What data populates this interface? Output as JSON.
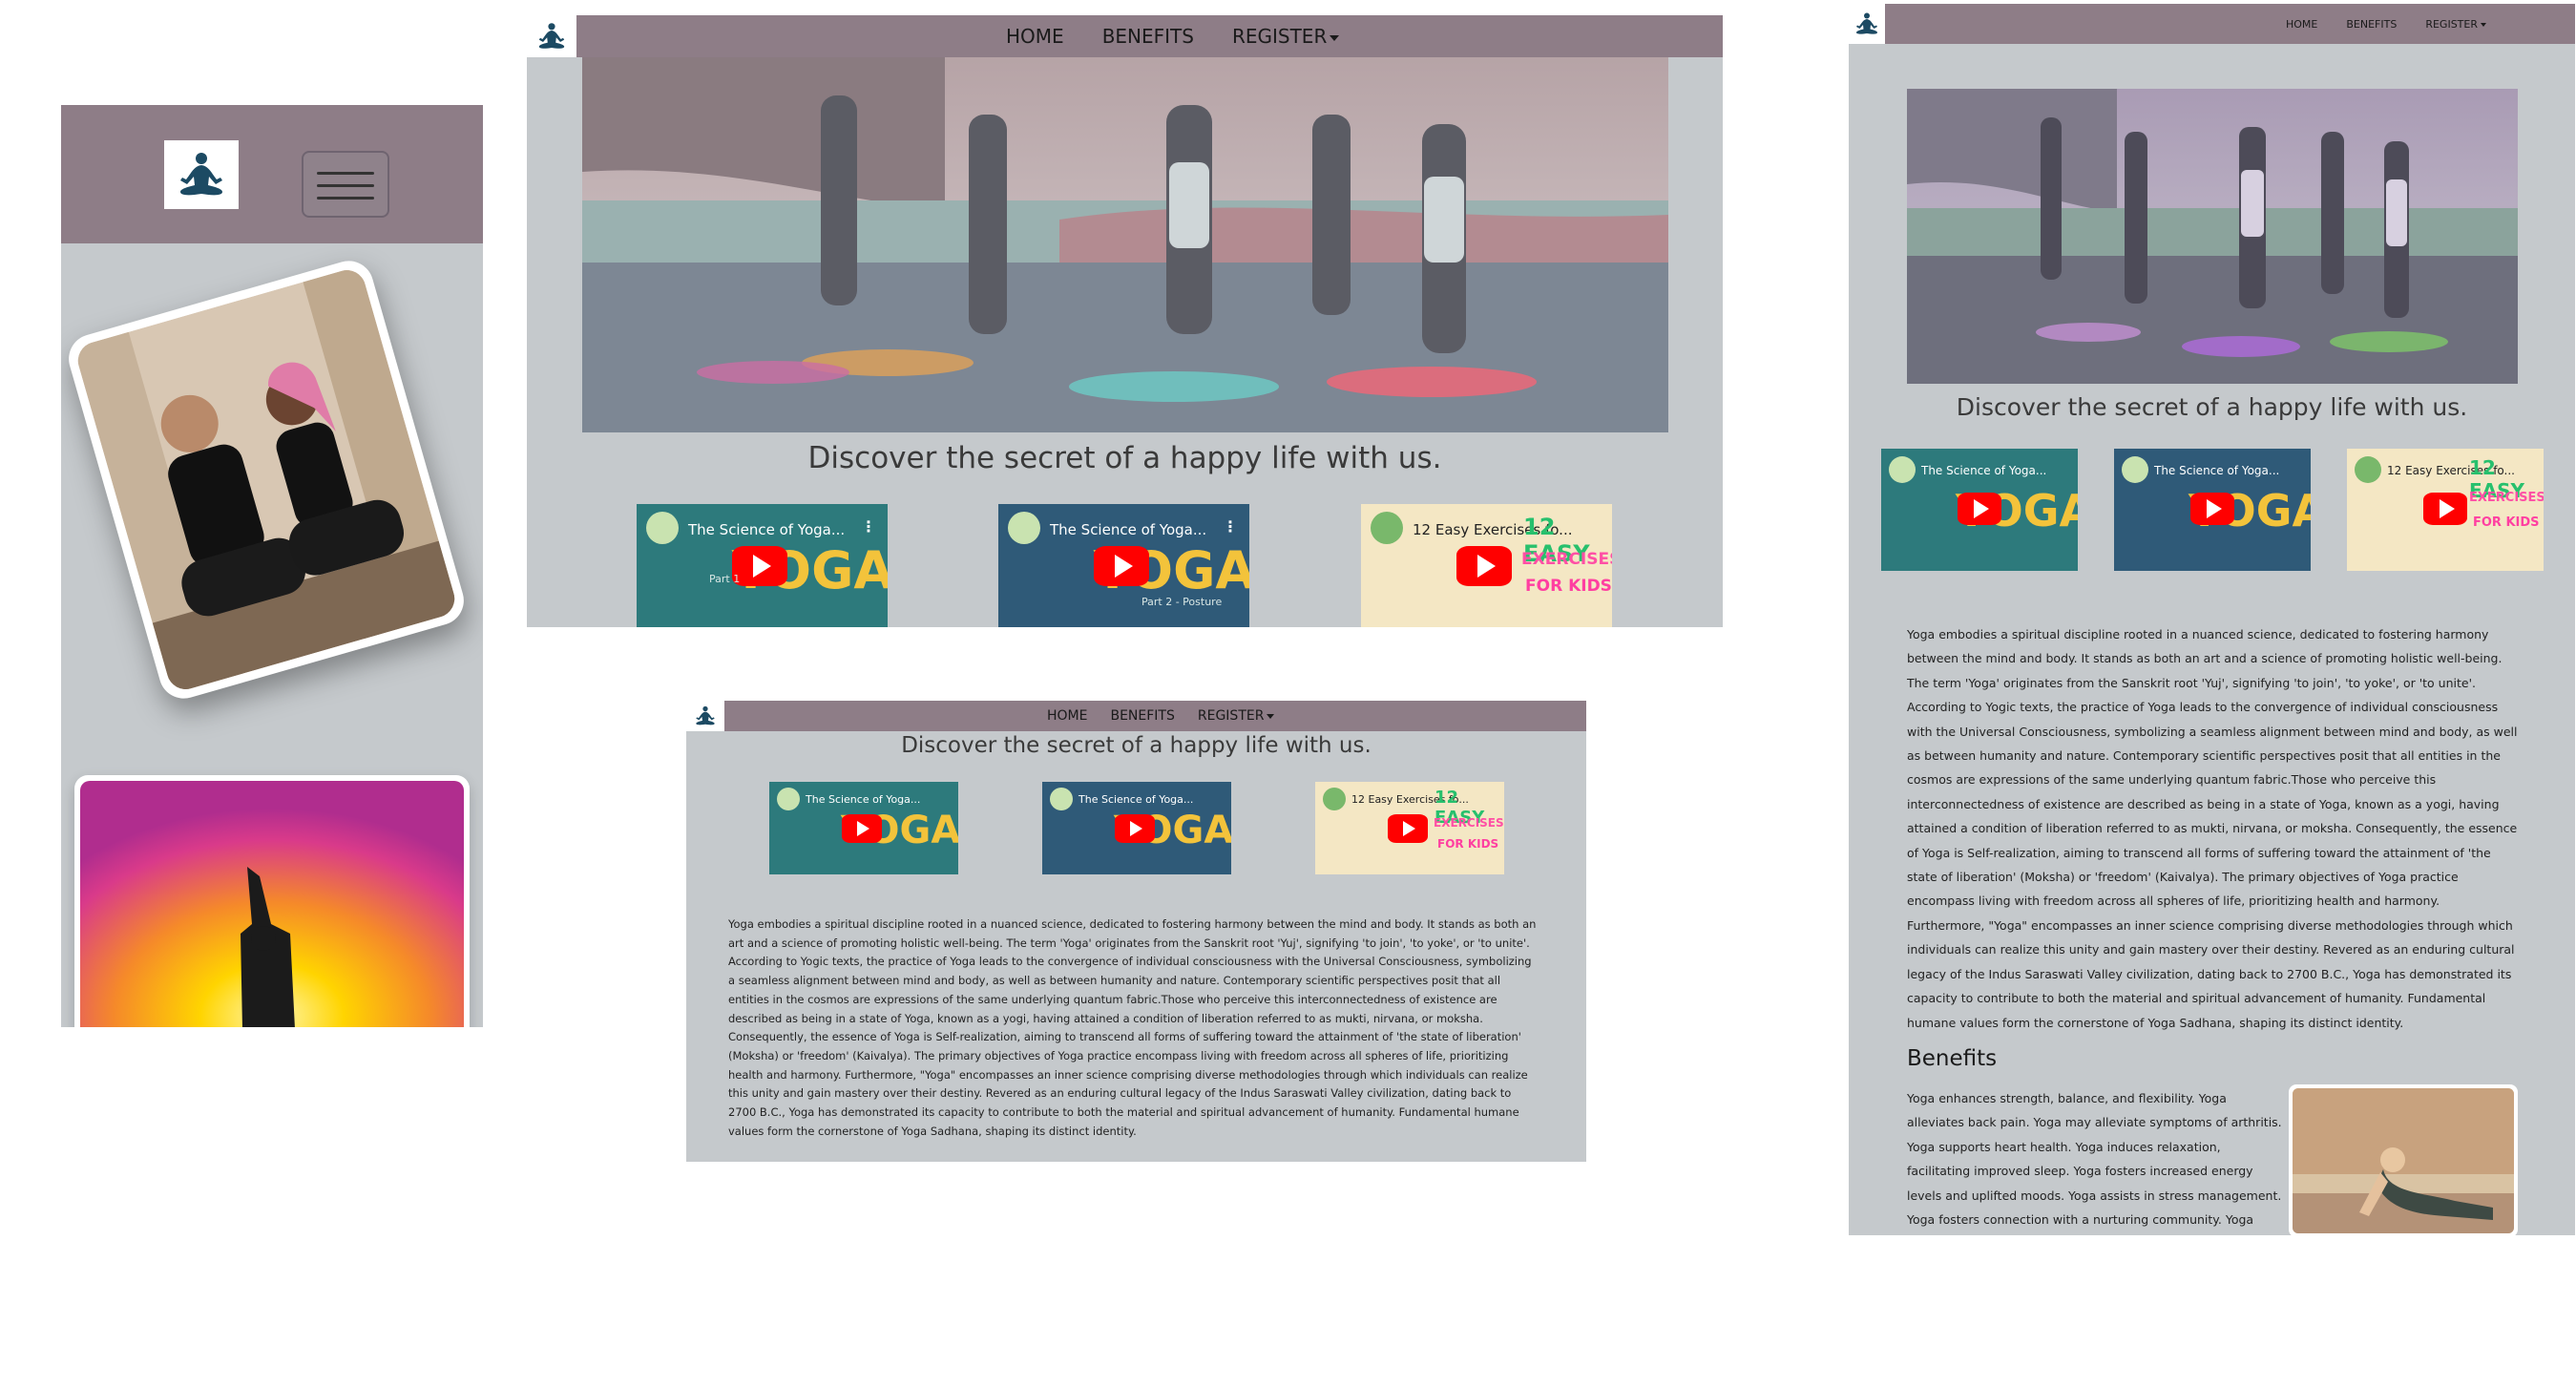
{
  "nav": {
    "home": "HOME",
    "benefits": "BENEFITS",
    "register": "REGISTER"
  },
  "tagline": "Discover the secret of a happy life with us.",
  "videos": [
    {
      "title": "The Science of Yoga...",
      "big": "YOGA",
      "sub": "Part 1"
    },
    {
      "title": "The Science of Yoga...",
      "big": "YOGA",
      "sub": "Part 2 - Posture"
    },
    {
      "title": "12 Easy Exercises fo...",
      "big": "12 EASY",
      "sub": "EXERCISES",
      "kids": "FOR KIDS"
    }
  ],
  "about_text": "Yoga embodies a spiritual discipline rooted in a nuanced science, dedicated to fostering harmony between the mind and body. It stands as both an art and a science of promoting holistic well-being. The term 'Yoga' originates from the Sanskrit root 'Yuj', signifying 'to join', 'to yoke', or 'to unite'. According to Yogic texts, the practice of Yoga leads to the convergence of individual consciousness with the Universal Consciousness, symbolizing a seamless alignment between mind and body, as well as between humanity and nature. Contemporary scientific perspectives posit that all entities in the cosmos are expressions of the same underlying quantum fabric.Those who perceive this interconnectedness of existence are described as being in a state of Yoga, known as a yogi, having attained a condition of liberation referred to as mukti, nirvana, or moksha. Consequently, the essence of Yoga is Self-realization, aiming to transcend all forms of suffering toward the attainment of 'the state of liberation' (Moksha) or 'freedom' (Kaivalya). The primary objectives of Yoga practice encompass living with freedom across all spheres of life, prioritizing health and harmony. Furthermore, \"Yoga\" encompasses an inner science comprising diverse methodologies through which individuals can realize this unity and gain mastery over their destiny. Revered as an enduring cultural legacy of the Indus Saraswati Valley civilization, dating back to 2700 B.C., Yoga has demonstrated its capacity to contribute to both the material and spiritual advancement of humanity. Fundamental humane values form the cornerstone of Yoga Sadhana, shaping its distinct identity.",
  "benefits_heading": "Benefits",
  "benefits_text": "Yoga enhances strength, balance, and flexibility. Yoga alleviates back pain. Yoga may alleviate symptoms of arthritis. Yoga supports heart health. Yoga induces relaxation, facilitating improved sleep. Yoga fosters increased energy levels and uplifted moods. Yoga assists in stress management. Yoga fosters connection with a nurturing community. Yoga encourages",
  "colors": {
    "navbar": "#8e7d87",
    "panel_bg": "#c5c9cc",
    "play": "#ff0000"
  },
  "icons": {
    "logo": "meditation-icon",
    "menu": "hamburger-icon",
    "play": "play-icon"
  }
}
